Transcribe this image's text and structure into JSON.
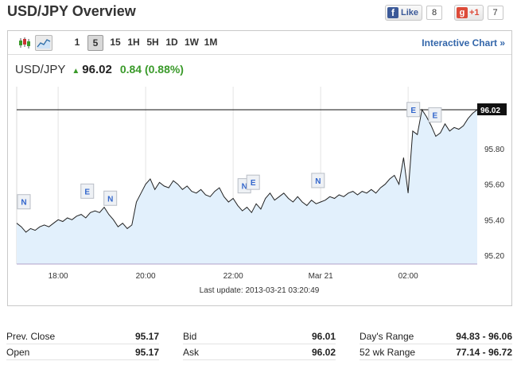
{
  "header": {
    "title": "USD/JPY Overview"
  },
  "social": {
    "facebook": {
      "label": "Like",
      "count": "8"
    },
    "gplus": {
      "label": "+1",
      "count": "7"
    }
  },
  "toolbar": {
    "ranges": [
      "1",
      "5",
      "15",
      "1H",
      "5H",
      "1D",
      "1W",
      "1M"
    ],
    "selected_range": "5",
    "interactive_label": "Interactive Chart »"
  },
  "quote": {
    "symbol": "USD/JPY",
    "price": "96.02",
    "change": "0.84 (0.88%)"
  },
  "chart_data": {
    "type": "area",
    "current_price": 96.02,
    "current_label": "96.02",
    "ylim": [
      95.15,
      96.15
    ],
    "y_ticks": [
      "95.80",
      "95.60",
      "95.40",
      "95.20"
    ],
    "y_tick_values": [
      95.8,
      95.6,
      95.4,
      95.2
    ],
    "x_ticks": [
      "18:00",
      "20:00",
      "22:00",
      "Mar 21",
      "02:00"
    ],
    "x_tick_values": [
      0.09,
      0.28,
      0.47,
      0.66,
      0.85
    ],
    "x": [
      0.0,
      0.01,
      0.02,
      0.03,
      0.04,
      0.05,
      0.06,
      0.07,
      0.08,
      0.09,
      0.1,
      0.11,
      0.12,
      0.13,
      0.14,
      0.15,
      0.16,
      0.17,
      0.18,
      0.19,
      0.2,
      0.21,
      0.22,
      0.23,
      0.24,
      0.25,
      0.26,
      0.27,
      0.28,
      0.29,
      0.3,
      0.31,
      0.32,
      0.33,
      0.34,
      0.35,
      0.36,
      0.37,
      0.38,
      0.39,
      0.4,
      0.41,
      0.42,
      0.43,
      0.44,
      0.45,
      0.46,
      0.47,
      0.48,
      0.49,
      0.5,
      0.51,
      0.52,
      0.53,
      0.54,
      0.55,
      0.56,
      0.57,
      0.58,
      0.59,
      0.6,
      0.61,
      0.62,
      0.63,
      0.64,
      0.65,
      0.66,
      0.67,
      0.68,
      0.69,
      0.7,
      0.71,
      0.72,
      0.73,
      0.74,
      0.75,
      0.76,
      0.77,
      0.78,
      0.79,
      0.8,
      0.81,
      0.82,
      0.83,
      0.84,
      0.85,
      0.86,
      0.87,
      0.88,
      0.89,
      0.9,
      0.91,
      0.92,
      0.93,
      0.94,
      0.95,
      0.96,
      0.97,
      0.98,
      0.99,
      1.0
    ],
    "values": [
      95.38,
      95.36,
      95.33,
      95.35,
      95.34,
      95.36,
      95.37,
      95.36,
      95.38,
      95.4,
      95.39,
      95.41,
      95.4,
      95.42,
      95.43,
      95.41,
      95.44,
      95.45,
      95.44,
      95.47,
      95.43,
      95.4,
      95.36,
      95.38,
      95.35,
      95.37,
      95.5,
      95.55,
      95.6,
      95.63,
      95.57,
      95.61,
      95.59,
      95.58,
      95.62,
      95.6,
      95.57,
      95.59,
      95.56,
      95.55,
      95.57,
      95.54,
      95.53,
      95.56,
      95.58,
      95.53,
      95.5,
      95.52,
      95.48,
      95.45,
      95.47,
      95.44,
      95.49,
      95.46,
      95.52,
      95.55,
      95.51,
      95.53,
      95.55,
      95.52,
      95.5,
      95.53,
      95.5,
      95.48,
      95.51,
      95.49,
      95.5,
      95.51,
      95.53,
      95.52,
      95.54,
      95.53,
      95.55,
      95.56,
      95.54,
      95.56,
      95.55,
      95.57,
      95.55,
      95.58,
      95.6,
      95.63,
      95.65,
      95.6,
      95.75,
      95.55,
      95.9,
      95.88,
      96.02,
      95.98,
      95.93,
      95.87,
      95.89,
      95.94,
      95.9,
      95.92,
      95.91,
      95.93,
      95.97,
      96.0,
      96.02
    ],
    "event_markers": [
      {
        "label": "N",
        "x": 0.0
      },
      {
        "label": "E",
        "x": 0.155
      },
      {
        "label": "N",
        "x": 0.205
      },
      {
        "label": "N",
        "x": 0.496
      },
      {
        "label": "E",
        "x": 0.515
      },
      {
        "label": "N",
        "x": 0.656
      },
      {
        "label": "E",
        "x": 0.863
      },
      {
        "label": "E",
        "x": 0.91
      }
    ],
    "last_update": "Last update: 2013-03-21 03:20:49",
    "grid": "vertical"
  },
  "stats": {
    "rows": [
      [
        [
          "Prev. Close",
          "95.17"
        ],
        [
          "Bid",
          "96.01"
        ],
        [
          "Day's Range",
          "94.83 - 96.06"
        ]
      ],
      [
        [
          "Open",
          "95.17"
        ],
        [
          "Ask",
          "96.02"
        ],
        [
          "52 wk Range",
          "77.14 - 96.72"
        ]
      ]
    ]
  }
}
